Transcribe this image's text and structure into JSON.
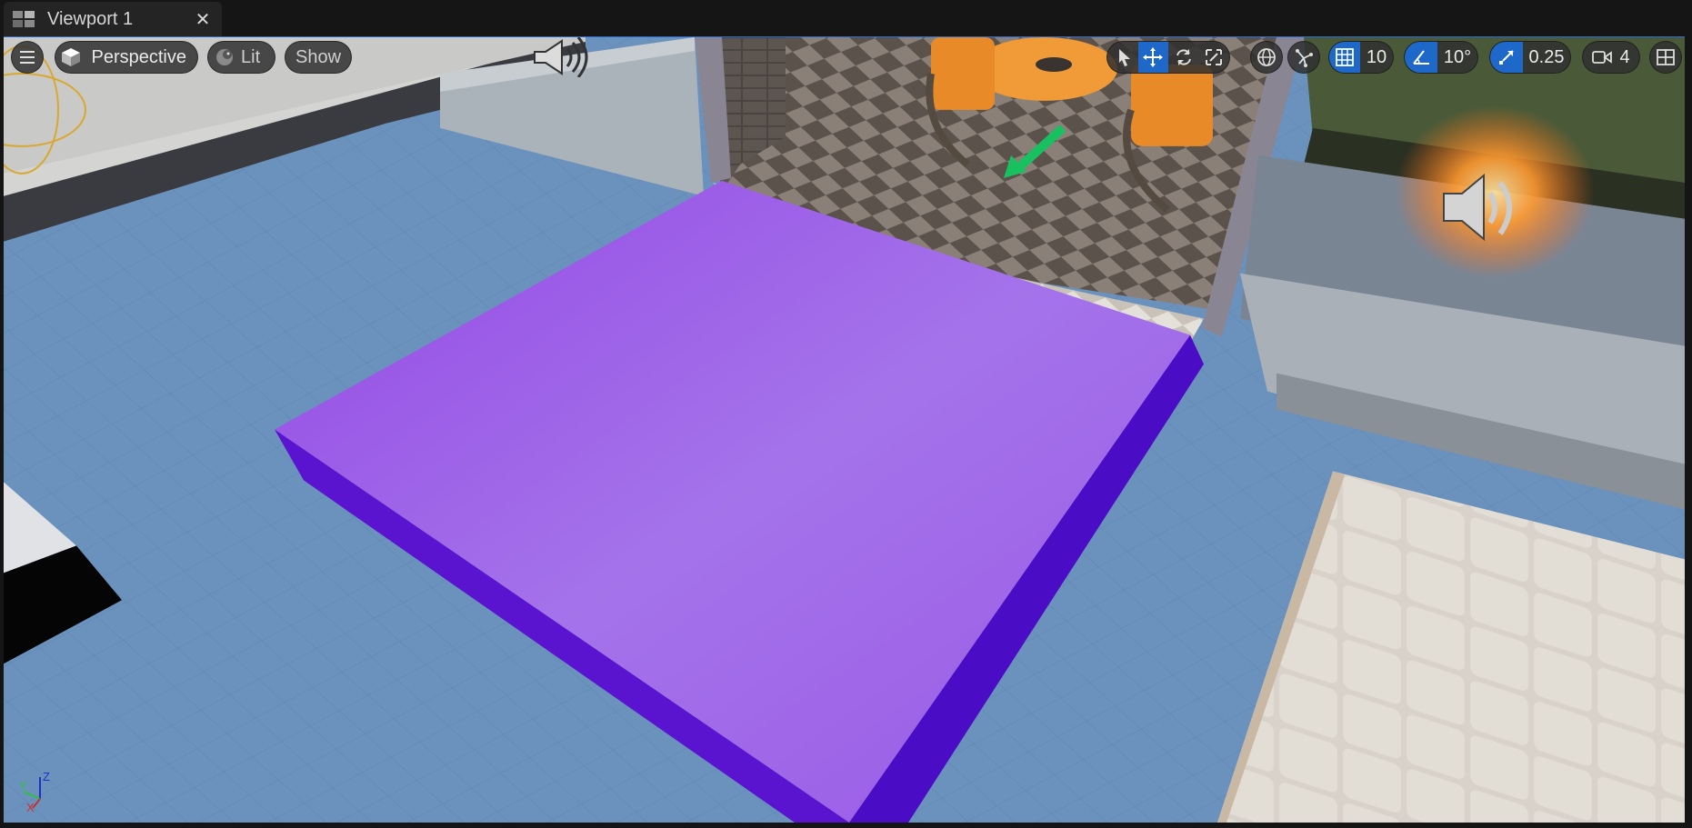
{
  "tab": {
    "title": "Viewport 1",
    "icon": "viewport-layout-icon",
    "close_icon": "close-icon",
    "close_glyph": "✕"
  },
  "viewport_toolbar": {
    "menu_icon": "hamburger-menu-icon",
    "view_mode": {
      "icon": "perspective-cube-icon",
      "label": "Perspective"
    },
    "lighting_mode": {
      "icon": "lit-sphere-icon",
      "label": "Lit"
    },
    "show_label": "Show",
    "transform_tools": [
      {
        "name": "select",
        "icon": "select-arrow-icon",
        "active": false
      },
      {
        "name": "translate",
        "icon": "translate-move-icon",
        "active": true
      },
      {
        "name": "rotate",
        "icon": "rotate-icon",
        "active": false
      },
      {
        "name": "scale",
        "icon": "scale-icon",
        "active": false
      }
    ],
    "coordinate_space_icon": "world-globe-icon",
    "surface_snapping_icon": "surface-snapping-icon",
    "grid_snap": {
      "icon": "grid-icon",
      "enabled": true,
      "value": "10"
    },
    "rotation_snap": {
      "icon": "angle-icon",
      "enabled": true,
      "value": "10°"
    },
    "scale_snap": {
      "icon": "scale-arrow-icon",
      "enabled": true,
      "value": "0.25"
    },
    "camera_speed": {
      "icon": "camera-icon",
      "value": "4"
    },
    "layout_icon": "viewport-layout-icon"
  },
  "axis_indicator": {
    "x": "X",
    "y": "Y",
    "z": "Z"
  },
  "scene": {
    "selected_object_color": "#9a5ce8",
    "selected_object_side_color": "#5a14d0",
    "ground_color": "#6a92bd",
    "gizmo_color": "#18c060"
  }
}
